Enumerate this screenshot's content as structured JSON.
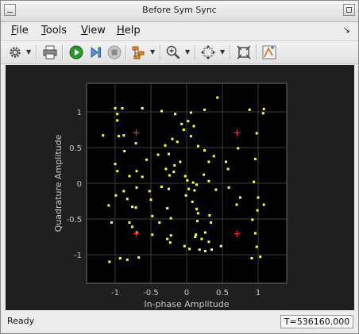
{
  "window": {
    "title": "Before Sym Sync"
  },
  "menu": [
    {
      "label": "File",
      "mnemonic": "F",
      "rest": "ile"
    },
    {
      "label": "Tools",
      "mnemonic": "T",
      "rest": "ools"
    },
    {
      "label": "View",
      "mnemonic": "V",
      "rest": "iew"
    },
    {
      "label": "Help",
      "mnemonic": "H",
      "rest": "elp"
    }
  ],
  "toolbar": {
    "icons": [
      "gear-icon",
      "print-icon",
      "run-icon",
      "step-icon",
      "stop-icon",
      "style-icon",
      "zoom-in-icon",
      "fit-icon",
      "autoscale-icon",
      "measure-icon"
    ]
  },
  "status": {
    "text": "Ready",
    "time": "T=536160.000"
  },
  "colors": {
    "plot_bg": "#000000",
    "axes_bg": "#1f1f1f",
    "points": "#ffff3c",
    "reference": "#ff2020",
    "axis_text": "#c8c8c8",
    "grid": "#3c3c3c"
  },
  "chart_data": {
    "type": "scatter",
    "xlabel": "In-phase Amplitude",
    "ylabel": "Quadrature Amplitude",
    "xlim": [
      -1.4,
      1.4
    ],
    "ylim": [
      -1.4,
      1.4
    ],
    "xticks": [
      "-1",
      "-0.5",
      "0",
      "0.5",
      "1"
    ],
    "yticks": [
      "1",
      "0.5",
      "0",
      "-0.5",
      "-1"
    ],
    "xtick_values": [
      -1,
      -0.5,
      0,
      0.5,
      1
    ],
    "ytick_values": [
      1,
      0.5,
      0,
      -0.5,
      -1
    ],
    "grid": true,
    "reference_points": [
      [
        -0.707,
        0.707
      ],
      [
        0.707,
        0.707
      ],
      [
        -0.707,
        -0.707
      ],
      [
        0.707,
        -0.707
      ]
    ],
    "samples": [
      [
        -1.17,
        0.67
      ],
      [
        -1.0,
        1.05
      ],
      [
        -0.97,
        0.97
      ],
      [
        -0.9,
        1.05
      ],
      [
        -0.97,
        0.88
      ],
      [
        -0.95,
        0.66
      ],
      [
        -0.88,
        0.67
      ],
      [
        -0.62,
        1.05
      ],
      [
        -0.35,
        1.01
      ],
      [
        -0.16,
        0.97
      ],
      [
        0.06,
        0.99
      ],
      [
        0.25,
        1.03
      ],
      [
        0.43,
        1.2
      ],
      [
        0.88,
        1.03
      ],
      [
        1.08,
        1.04
      ],
      [
        1.07,
        0.98
      ],
      [
        0.98,
        0.7
      ],
      [
        -1.0,
        0.27
      ],
      [
        -0.97,
        0.17
      ],
      [
        -0.71,
        0.56
      ],
      [
        -0.7,
        0.17
      ],
      [
        -0.87,
        0.45
      ],
      [
        -0.56,
        0.33
      ],
      [
        -0.4,
        0.4
      ],
      [
        -0.3,
        0.53
      ],
      [
        -0.2,
        0.62
      ],
      [
        -0.13,
        0.58
      ],
      [
        -0.07,
        0.83
      ],
      [
        -0.04,
        0.75
      ],
      [
        0.02,
        0.87
      ],
      [
        -0.25,
        0.41
      ],
      [
        -0.09,
        0.3
      ],
      [
        -0.17,
        0.25
      ],
      [
        0.06,
        0.66
      ],
      [
        0.1,
        0.8
      ],
      [
        0.16,
        0.52
      ],
      [
        0.25,
        0.46
      ],
      [
        0.38,
        0.38
      ],
      [
        0.31,
        0.3
      ],
      [
        0.55,
        0.3
      ],
      [
        0.72,
        0.49
      ],
      [
        0.58,
        0.2
      ],
      [
        0.59,
        -0.06
      ],
      [
        0.75,
        -0.2
      ],
      [
        0.7,
        -0.3
      ],
      [
        0.96,
        0.34
      ],
      [
        0.94,
        0.02
      ],
      [
        1.0,
        -0.2
      ],
      [
        -0.8,
        0.1
      ],
      [
        -0.62,
        0.09
      ],
      [
        -0.52,
        -0.11
      ],
      [
        -0.5,
        -0.23
      ],
      [
        -0.7,
        -0.06
      ],
      [
        -0.88,
        -0.11
      ],
      [
        -0.83,
        -0.22
      ],
      [
        -0.71,
        -0.34
      ],
      [
        -0.76,
        -0.33
      ],
      [
        -0.99,
        -0.17
      ],
      [
        -0.29,
        0.2
      ],
      [
        -0.24,
        0.11
      ],
      [
        -0.35,
        -0.05
      ],
      [
        -0.25,
        -0.08
      ],
      [
        -0.18,
        0.16
      ],
      [
        -0.02,
        0.1
      ],
      [
        0.01,
        0.04
      ],
      [
        0.03,
        -0.08
      ],
      [
        0.11,
        -0.1
      ],
      [
        0.14,
        -0.02
      ],
      [
        0.09,
        0.01
      ],
      [
        0.24,
        0.12
      ],
      [
        0.31,
        0.03
      ],
      [
        0.41,
        -0.09
      ],
      [
        0.08,
        -0.26
      ],
      [
        -0.01,
        -0.17
      ],
      [
        -0.27,
        -0.35
      ],
      [
        -0.22,
        -0.49
      ],
      [
        -0.38,
        -0.55
      ],
      [
        -0.48,
        -0.46
      ],
      [
        0.14,
        -0.36
      ],
      [
        0.16,
        -0.42
      ],
      [
        0.32,
        -0.45
      ],
      [
        0.34,
        -0.55
      ],
      [
        0.15,
        -0.53
      ],
      [
        0.99,
        -0.38
      ],
      [
        1.08,
        -0.3
      ],
      [
        0.92,
        -0.51
      ],
      [
        0.96,
        -0.7
      ],
      [
        -1.09,
        -0.31
      ],
      [
        -1.05,
        -0.55
      ],
      [
        -0.8,
        -0.55
      ],
      [
        -0.76,
        -0.61
      ],
      [
        -0.7,
        -0.69
      ],
      [
        -0.48,
        -0.72
      ],
      [
        -0.27,
        -0.78
      ],
      [
        0.13,
        -0.72
      ],
      [
        0.12,
        -0.75
      ],
      [
        0.26,
        -0.69
      ],
      [
        0.21,
        -0.78
      ],
      [
        0.31,
        -0.82
      ],
      [
        -0.23,
        -0.83
      ],
      [
        0.04,
        -0.92
      ],
      [
        0.18,
        -0.93
      ],
      [
        0.26,
        -0.95
      ],
      [
        0.35,
        -0.93
      ],
      [
        0.98,
        -0.89
      ],
      [
        1.03,
        -1.03
      ],
      [
        0.91,
        -1.05
      ],
      [
        -1.08,
        -1.1
      ],
      [
        -0.93,
        -1.05
      ],
      [
        -0.83,
        -1.07
      ],
      [
        -0.67,
        -1.04
      ],
      [
        -0.03,
        -0.88
      ],
      [
        -0.22,
        -0.73
      ],
      [
        0.48,
        -0.88
      ]
    ]
  }
}
